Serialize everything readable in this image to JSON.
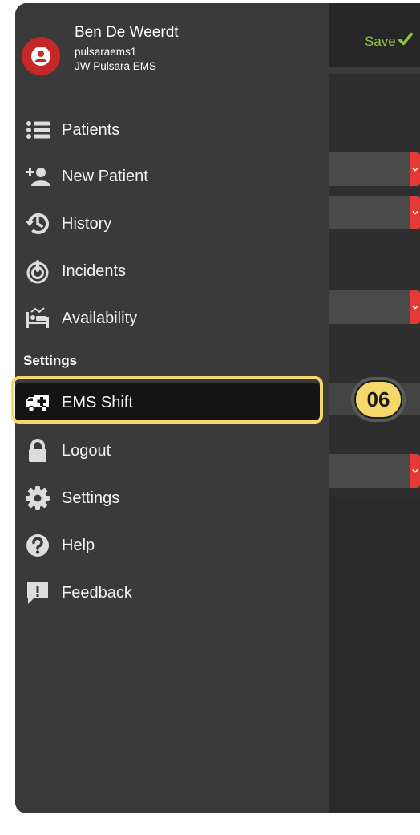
{
  "header": {
    "save_label": "Save"
  },
  "profile": {
    "name": "Ben De Weerdt",
    "username": "pulsaraems1",
    "organization": "JW Pulsara EMS"
  },
  "menu": {
    "items": [
      {
        "label": "Patients",
        "icon": "list-icon"
      },
      {
        "label": "New Patient",
        "icon": "add-user-icon"
      },
      {
        "label": "History",
        "icon": "history-icon"
      },
      {
        "label": "Incidents",
        "icon": "incidents-icon"
      },
      {
        "label": "Availability",
        "icon": "bed-icon"
      }
    ],
    "settings_heading": "Settings",
    "settings_items": [
      {
        "label": "EMS Shift",
        "icon": "ambulance-icon",
        "selected": true
      },
      {
        "label": "Logout",
        "icon": "lock-icon"
      },
      {
        "label": "Settings",
        "icon": "gear-icon"
      },
      {
        "label": "Help",
        "icon": "help-icon"
      },
      {
        "label": "Feedback",
        "icon": "feedback-icon"
      }
    ]
  },
  "annotation": {
    "badge": "06"
  },
  "colors": {
    "accent_green": "#8cc63f",
    "avatar_red": "#c62828",
    "highlight": "#f6d86a"
  }
}
